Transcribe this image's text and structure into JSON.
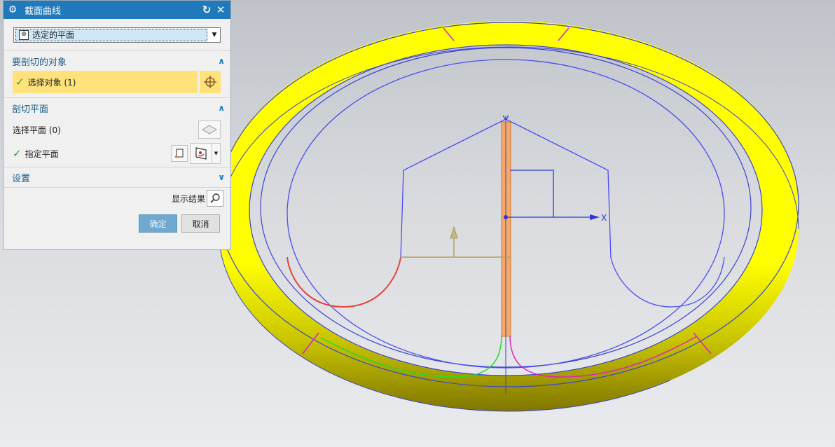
{
  "dialog": {
    "title": "截面曲线",
    "type_value": "选定的平面",
    "sections": {
      "objects": {
        "header": "要剖切的对象",
        "select_label": "选择对象 (1)"
      },
      "plane": {
        "header": "剖切平面",
        "select_plane_label": "选择平面 (0)",
        "specify_plane_label": "指定平面"
      },
      "settings": {
        "header": "设置"
      }
    },
    "show_result_label": "显示结果",
    "ok_label": "确定",
    "cancel_label": "取消"
  },
  "viewport": {
    "axis_label": "X"
  },
  "colors": {
    "title_bar": "#1f79bb",
    "highlight": "#ffe27a",
    "ring_yellow": "#ffff00",
    "curve_blue": "#4a4ef0",
    "curve_red": "#e0463c",
    "curve_green": "#22dd22",
    "curve_magenta": "#e021c0",
    "plane_orange": "#f5a868"
  },
  "icons": [
    "gear-icon",
    "reset-icon",
    "close-icon",
    "plane-type-icon",
    "crosshair-icon",
    "plane-diamond-icon",
    "plane-dialog-icon",
    "plane-inferred-icon",
    "magnifier-icon",
    "checkmark-icon"
  ]
}
